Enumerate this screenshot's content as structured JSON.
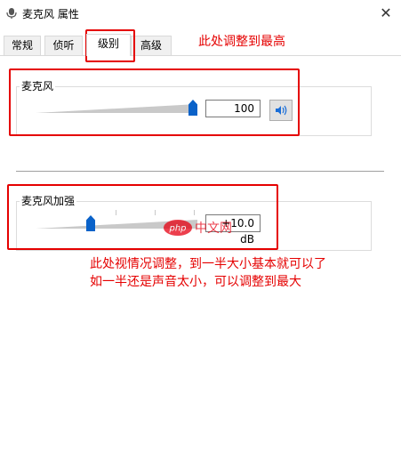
{
  "window": {
    "title": "麦克风 属性",
    "close_glyph": "✕",
    "icon": "microphone-icon"
  },
  "tabs": [
    {
      "label": "常规",
      "active": false
    },
    {
      "label": "侦听",
      "active": false
    },
    {
      "label": "级别",
      "active": true
    },
    {
      "label": "高级",
      "active": false
    }
  ],
  "microphone": {
    "group_label": "麦克风",
    "value": "100",
    "level_percent": 100,
    "speaker_icon": "speaker-icon"
  },
  "boost": {
    "group_label": "麦克风加强",
    "value": "+10.0 dB",
    "level_percent": 33
  },
  "annotations": {
    "top": "此处调整到最高",
    "bottom_line1": "此处视情况调整，到一半大小基本就可以了",
    "bottom_line2": "如一半还是声音太小，可以调整到最大",
    "color": "#e50000"
  },
  "watermark": {
    "text": "php 中文网"
  },
  "colors": {
    "accent": "#0a62c9",
    "annotation_red": "#e50000"
  }
}
